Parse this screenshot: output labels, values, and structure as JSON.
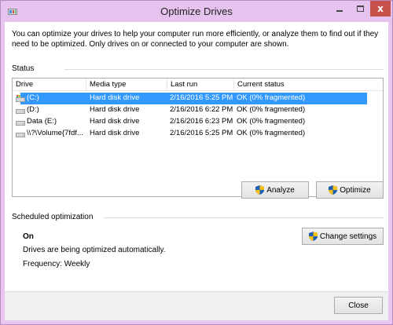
{
  "window": {
    "title": "Optimize Drives",
    "minimize_label": "minimize",
    "maximize_label": "maximize",
    "close_glyph": "x"
  },
  "intro_text": "You can optimize your drives to help your computer run more efficiently, or analyze them to find out if they need to be optimized. Only drives on or connected to your computer are shown.",
  "status": {
    "section_label": "Status",
    "columns": [
      "Drive",
      "Media type",
      "Last run",
      "Current status"
    ],
    "rows": [
      {
        "drive": "(C:)",
        "media": "Hard disk drive",
        "last_run": "2/16/2016 5:25 PM",
        "status": "OK (0% fragmented)",
        "selected": true,
        "icon": "windows-drive-icon"
      },
      {
        "drive": "(D:)",
        "media": "Hard disk drive",
        "last_run": "2/16/2016 6:22 PM",
        "status": "OK (0% fragmented)",
        "selected": false,
        "icon": "drive-icon"
      },
      {
        "drive": "Data (E:)",
        "media": "Hard disk drive",
        "last_run": "2/16/2016 6:23 PM",
        "status": "OK (0% fragmented)",
        "selected": false,
        "icon": "drive-icon"
      },
      {
        "drive": "\\\\?\\Volume{7fdf...",
        "media": "Hard disk drive",
        "last_run": "2/16/2016 5:25 PM",
        "status": "OK (0% fragmented)",
        "selected": false,
        "icon": "drive-icon"
      }
    ],
    "analyze_label": "Analyze",
    "optimize_label": "Optimize"
  },
  "scheduled": {
    "section_label": "Scheduled optimization",
    "state": "On",
    "description": "Drives are being optimized automatically.",
    "frequency": "Frequency: Weekly",
    "change_settings_label": "Change settings"
  },
  "footer": {
    "close_label": "Close"
  },
  "colors": {
    "selection": "#3399ff",
    "frame": "#e9c6f0",
    "close_button": "#c7504b"
  }
}
